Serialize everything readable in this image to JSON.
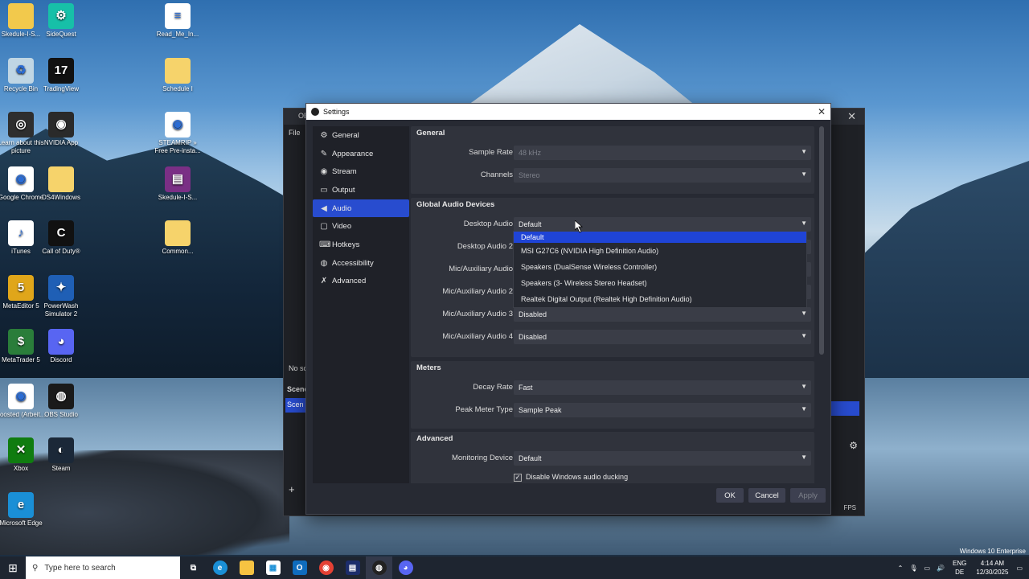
{
  "desktop": {
    "icons": [
      {
        "label": "Skedule-I-S...",
        "icon": "document-icon",
        "color": "#f2c94c",
        "glyph": ""
      },
      {
        "label": "SideQuest",
        "icon": "sidequest-icon",
        "color": "#17c0a8",
        "glyph": "⚙"
      },
      {
        "label": "Read_Me_In...",
        "icon": "text-file-icon",
        "color": "#ffffff",
        "glyph": "≡"
      },
      {
        "label": "Recycle Bin",
        "icon": "recycle-bin-icon",
        "color": "#c0d6e4",
        "glyph": "♻"
      },
      {
        "label": "TradingView",
        "icon": "tradingview-icon",
        "color": "#111111",
        "glyph": "17"
      },
      {
        "label": "Schedule I",
        "icon": "folder-icon",
        "color": "#f6d36b",
        "glyph": ""
      },
      {
        "label": "Learn about this picture",
        "icon": "camera-icon",
        "color": "#2e2e2e",
        "glyph": "◎"
      },
      {
        "label": "NVIDIA App",
        "icon": "nvidia-icon",
        "color": "#2a2a2a",
        "glyph": "◉"
      },
      {
        "label": "STEAMRIP » Free Pre-insta...",
        "icon": "chrome-icon",
        "color": "#ffffff",
        "glyph": "◉"
      },
      {
        "label": "Google Chrome",
        "icon": "chrome-icon",
        "color": "#ffffff",
        "glyph": "◉"
      },
      {
        "label": "DS4Windows",
        "icon": "folder-icon",
        "color": "#f6d36b",
        "glyph": ""
      },
      {
        "label": "Skedule-I-S...",
        "icon": "winrar-icon",
        "color": "#7a2f85",
        "glyph": "▤"
      },
      {
        "label": "iTunes",
        "icon": "itunes-icon",
        "color": "#ffffff",
        "glyph": "♪"
      },
      {
        "label": "Call of Duty®",
        "icon": "cod-icon",
        "color": "#111111",
        "glyph": "C"
      },
      {
        "label": "Common...",
        "icon": "folder-icon",
        "color": "#f6d36b",
        "glyph": ""
      },
      {
        "label": "MetaEditor 5",
        "icon": "metaeditor-icon",
        "color": "#e0a61a",
        "glyph": "5"
      },
      {
        "label": "PowerWash Simulator 2",
        "icon": "powerwash-icon",
        "color": "#1f5fb5",
        "glyph": "✦"
      },
      {
        "label": "MetaTrader 5",
        "icon": "metatrader-icon",
        "color": "#2a7d3a",
        "glyph": "$"
      },
      {
        "label": "Discord",
        "icon": "discord-icon",
        "color": "#5865f2",
        "glyph": "◕"
      },
      {
        "label": "boosted (Arbeit...",
        "icon": "chrome-icon",
        "color": "#ffffff",
        "glyph": "◉"
      },
      {
        "label": "OBS Studio",
        "icon": "obs-icon",
        "color": "#1a1a1a",
        "glyph": "◍"
      },
      {
        "label": "Xbox",
        "icon": "xbox-icon",
        "color": "#107c10",
        "glyph": "✕"
      },
      {
        "label": "Steam",
        "icon": "steam-icon",
        "color": "#1b2838",
        "glyph": "◐"
      },
      {
        "label": "Microsoft Edge",
        "icon": "edge-icon",
        "color": "#1a8fd6",
        "glyph": "e"
      }
    ]
  },
  "obs_main": {
    "title": "OB",
    "menu_file": "File",
    "no_source": "No sc",
    "scenes_title": "Scene",
    "scene_item": "Scen",
    "fps": "FPS",
    "add": "+"
  },
  "settings": {
    "title": "Settings",
    "sidebar": [
      {
        "label": "General",
        "icon": "gear-icon",
        "glyph": "⚙"
      },
      {
        "label": "Appearance",
        "icon": "brush-icon",
        "glyph": "✎"
      },
      {
        "label": "Stream",
        "icon": "globe-icon",
        "glyph": "◉"
      },
      {
        "label": "Output",
        "icon": "output-icon",
        "glyph": "▭"
      },
      {
        "label": "Audio",
        "icon": "speaker-icon",
        "glyph": "◀"
      },
      {
        "label": "Video",
        "icon": "monitor-icon",
        "glyph": "▢"
      },
      {
        "label": "Hotkeys",
        "icon": "keyboard-icon",
        "glyph": "⌨"
      },
      {
        "label": "Accessibility",
        "icon": "accessibility-icon",
        "glyph": "◍"
      },
      {
        "label": "Advanced",
        "icon": "wrench-icon",
        "glyph": "✗"
      }
    ],
    "general": {
      "title": "General",
      "sample_rate_label": "Sample Rate",
      "sample_rate_value": "48 kHz",
      "channels_label": "Channels",
      "channels_value": "Stereo"
    },
    "global_audio": {
      "title": "Global Audio Devices",
      "rows": [
        {
          "label": "Desktop Audio",
          "value": "Default"
        },
        {
          "label": "Desktop Audio 2",
          "value": ""
        },
        {
          "label": "Mic/Auxiliary Audio",
          "value": ""
        },
        {
          "label": "Mic/Auxiliary Audio 2",
          "value": ""
        },
        {
          "label": "Mic/Auxiliary Audio 3",
          "value": "Disabled"
        },
        {
          "label": "Mic/Auxiliary Audio 4",
          "value": "Disabled"
        }
      ]
    },
    "dropdown_options": [
      "Default",
      "MSI G27C6 (NVIDIA High Definition Audio)",
      "Speakers (DualSense Wireless Controller)",
      "Speakers (3- Wireless Stereo Headset)",
      "Realtek Digital Output (Realtek High Definition Audio)"
    ],
    "meters": {
      "title": "Meters",
      "decay_label": "Decay Rate",
      "decay_value": "Fast",
      "peak_label": "Peak Meter Type",
      "peak_value": "Sample Peak"
    },
    "advanced": {
      "title": "Advanced",
      "monitoring_label": "Monitoring Device",
      "monitoring_value": "Default",
      "ducking_label": "Disable Windows audio ducking",
      "ducking_checked": true
    },
    "buttons": {
      "ok": "OK",
      "cancel": "Cancel",
      "apply": "Apply"
    }
  },
  "taskbar": {
    "search_placeholder": "Type here to search",
    "lang": "ENG",
    "region": "DE",
    "time": "4:14 AM",
    "date": "12/30/2025",
    "watermark": "Windows 10 Enterprise"
  }
}
